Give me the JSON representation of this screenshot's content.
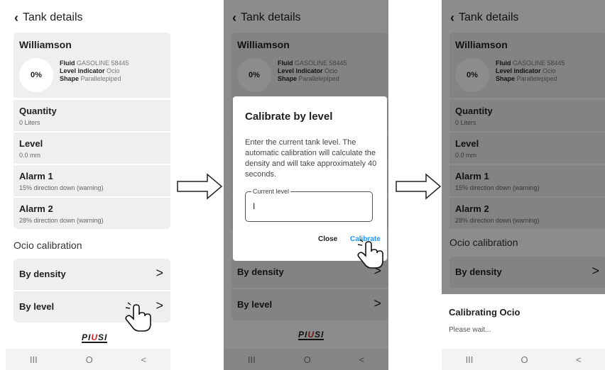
{
  "screen": {
    "title": "Tank details",
    "tank": {
      "name": "Williamson",
      "level_percent": "0%",
      "fluid_label": "Fluid",
      "fluid_value": "GASOLINE 58445",
      "indicator_label": "Level indicator",
      "indicator_value": "Ocio",
      "shape_label": "Shape",
      "shape_value": "Parallelepiped"
    },
    "rows": [
      {
        "title": "Quantity",
        "sub": "0 Liters"
      },
      {
        "title": "Level",
        "sub": "0.0 mm"
      },
      {
        "title": "Alarm 1",
        "sub": "15% direction down (warning)"
      },
      {
        "title": "Alarm 2",
        "sub": "28% direction down (warning)"
      }
    ],
    "calibration_title": "Ocio calibration",
    "by_density": "By density",
    "by_level": "By level",
    "chevron": ">",
    "logo_left": "PI",
    "logo_mid": "U",
    "logo_right": "SI",
    "nav": {
      "recents": "III",
      "home": "O",
      "back": "<"
    }
  },
  "dialog": {
    "title": "Calibrate by level",
    "body": "Enter the current tank level. The automatic calibration will calculate the density and will take approximately 40 seconds.",
    "field_label": "Current level",
    "field_cursor": "I",
    "close": "Close",
    "calibrate": "Calibrate"
  },
  "sheet": {
    "title": "Calibrating Ocio",
    "subtitle": "Please wait..."
  },
  "colors": {
    "card": "#efefef",
    "accent": "#2196f3",
    "logo_red": "#d12020",
    "scrim": "rgba(0,0,0,0.45)"
  }
}
